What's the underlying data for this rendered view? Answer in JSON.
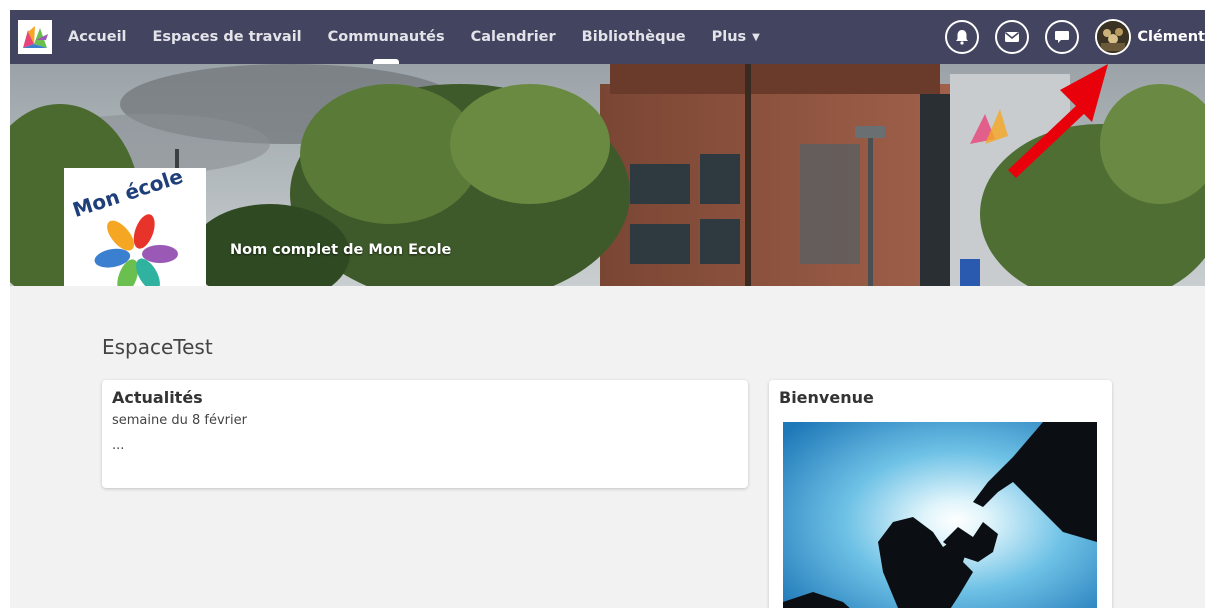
{
  "nav": {
    "items": [
      {
        "label": "Accueil",
        "name": "nav-item-accueil",
        "active": false
      },
      {
        "label": "Espaces de travail",
        "name": "nav-item-espaces",
        "active": false
      },
      {
        "label": "Communautés",
        "name": "nav-item-communautes",
        "active": true
      },
      {
        "label": "Calendrier",
        "name": "nav-item-calendrier",
        "active": false
      },
      {
        "label": "Bibliothèque",
        "name": "nav-item-bibliotheque",
        "active": false
      },
      {
        "label": "Plus",
        "name": "nav-item-plus",
        "active": false
      }
    ],
    "icons": [
      "bell-icon",
      "mail-icon",
      "chat-icon"
    ],
    "user_name": "Clément"
  },
  "banner": {
    "logo_text": "Mon école",
    "school_name": "Nom complet de Mon Ecole"
  },
  "space": {
    "title": "EspaceTest"
  },
  "news": {
    "title": "Actualités",
    "subtitle": "semaine du 8 février",
    "body": "..."
  },
  "welcome": {
    "title": "Bienvenue"
  },
  "colors": {
    "nav_bg": "#43445f",
    "page_bg": "#f2f2f2",
    "annotation_red": "#e8000b"
  }
}
